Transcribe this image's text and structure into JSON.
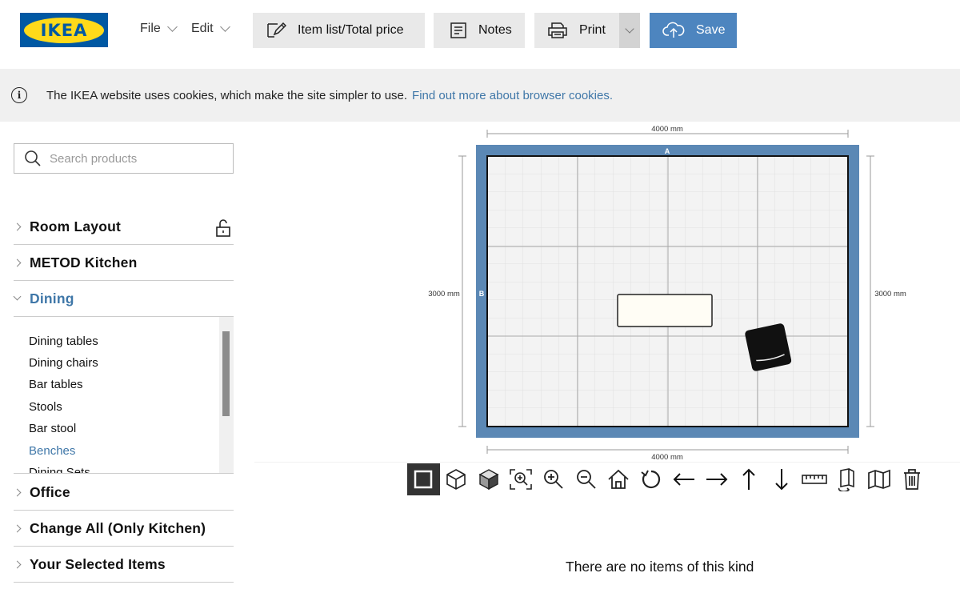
{
  "header": {
    "logo_text": "IKEA",
    "menu_file": "File",
    "menu_edit": "Edit",
    "item_list_label": "Item list/Total price",
    "notes_label": "Notes",
    "print_label": "Print",
    "save_label": "Save",
    "colors": {
      "logo_blue": "#0058a3",
      "logo_yellow": "#ffda1a",
      "save_blue": "#4d85bf"
    }
  },
  "cookie_bar": {
    "message": "The IKEA website uses cookies, which make the site simpler to use.",
    "link": "Find out more about browser cookies."
  },
  "sidebar": {
    "search_placeholder": "Search products",
    "categories": [
      {
        "label": "Room Layout",
        "icon": "unlock-icon"
      },
      {
        "label": "METOD Kitchen"
      },
      {
        "label": "Dining",
        "expanded": true
      },
      {
        "label": "Office"
      },
      {
        "label": "Change All (Only Kitchen)"
      },
      {
        "label": "Your Selected Items"
      }
    ],
    "dining_items": [
      "Dining tables",
      "Dining chairs",
      "Bar tables",
      "Stools",
      "Bar stool",
      "Benches",
      "Dining Sets"
    ],
    "active_item": "Benches"
  },
  "plan": {
    "width_label": "4000 mm",
    "height_label": "3000 mm",
    "wall_a": "A",
    "wall_b": "B",
    "wall_color": "#5b88b5"
  },
  "toolbar_icons": [
    "2d-view-icon",
    "3d-wireframe-icon",
    "3d-solid-icon",
    "zoom-fit-icon",
    "zoom-in-icon",
    "zoom-out-icon",
    "home-icon",
    "rotate-icon",
    "arrow-left-icon",
    "arrow-right-icon",
    "arrow-up-icon",
    "arrow-down-icon",
    "ruler-icon",
    "wall-icon",
    "map-icon",
    "trash-icon"
  ],
  "empty_message": "There are no items of this kind"
}
